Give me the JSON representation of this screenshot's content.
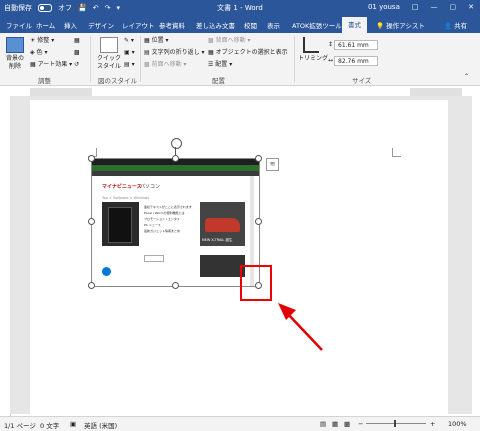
{
  "titlebar": {
    "autosave": "自動保存",
    "autosave_state": "オフ",
    "title": "文書 1 - Word",
    "user": "01 yousa",
    "colors": {
      "bg": "#2b579a"
    }
  },
  "tabs": [
    "ファイル",
    "ホーム",
    "挿入",
    "デザイン",
    "レイアウト",
    "参考資料",
    "差し込み文書",
    "校閲",
    "表示",
    "ATOK拡張ツール",
    "書式"
  ],
  "active_tab": "書式",
  "tell_me": "操作アシスト",
  "share": "共有",
  "ribbon": {
    "remove_bg": "背景の削除",
    "adjust": [
      "修整",
      "色",
      "アート効果"
    ],
    "quick_style": "クイックスタイル",
    "arrange": [
      "位置",
      "文字列の折り返し",
      "前面へ移動",
      "背面へ移動",
      "オブジェクトの選択と表示",
      "配置"
    ],
    "crop": "トリミング",
    "height": "61.61 mm",
    "width": "82.76 mm",
    "groups": [
      "調整",
      "図のスタイル",
      "配置",
      "サイズ"
    ]
  },
  "screenshot_text": {
    "logo1": "マイナビニュース",
    "logo2": "パソコン",
    "breadcrumb": "Top > Software > Windows",
    "ad": "NEW X-TRAIL 誕生",
    "links": [
      "連続テキストがここに表示されます",
      "Excel / Word の便利機能とは",
      "プロモーション / エンタメ",
      "PC ニュース",
      "最新ガジェット情報まとめ"
    ]
  },
  "status": {
    "page": "1/1 ページ",
    "words": "0 文字",
    "lang": "英語 (米国)",
    "zoom": "100%"
  },
  "colors": {
    "accent": "#2b579a",
    "highlight": "#e00000"
  }
}
